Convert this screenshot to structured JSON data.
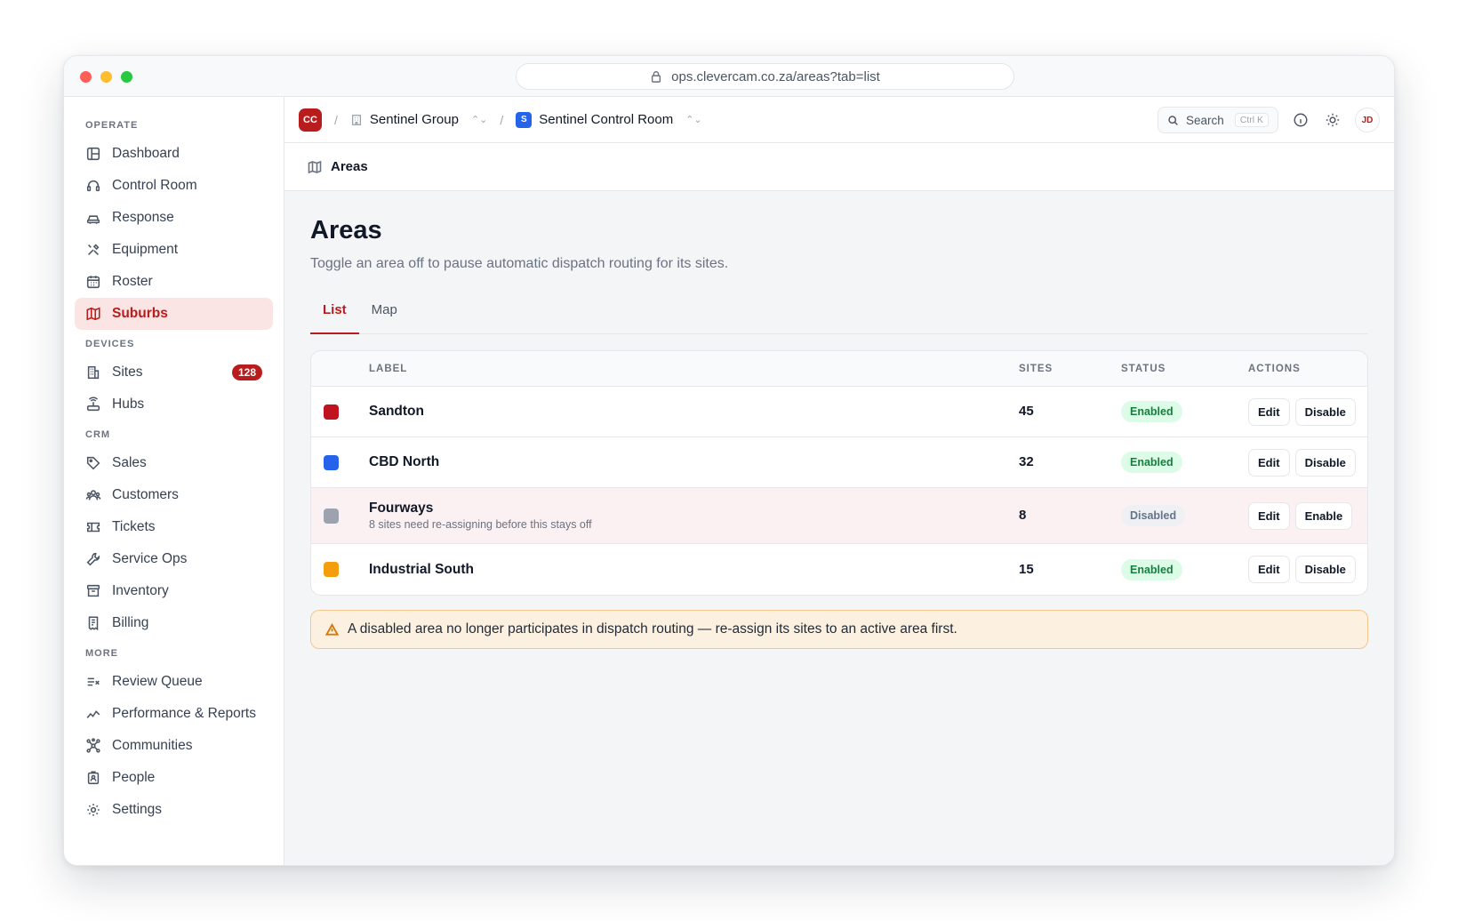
{
  "browser": {
    "url": "ops.clevercam.co.za/areas?tab=list"
  },
  "topbar": {
    "logo": "CC",
    "org": "Sentinel Group",
    "workspace_badge": "S",
    "workspace": "Sentinel Control Room",
    "search_label": "Search",
    "search_shortcut": "Ctrl K",
    "avatar": "JD"
  },
  "sidebar": {
    "sections": [
      {
        "title": "OPERATE",
        "items": [
          {
            "label": "Dashboard",
            "icon": "layout-icon"
          },
          {
            "label": "Control Room",
            "icon": "headset-icon"
          },
          {
            "label": "Response",
            "icon": "car-icon"
          },
          {
            "label": "Equipment",
            "icon": "tools-icon"
          },
          {
            "label": "Roster",
            "icon": "calendar-icon"
          },
          {
            "label": "Suburbs",
            "icon": "map-icon",
            "active": true
          }
        ]
      },
      {
        "title": "DEVICES",
        "items": [
          {
            "label": "Sites",
            "icon": "building-icon",
            "badge": "128"
          },
          {
            "label": "Hubs",
            "icon": "router-icon"
          }
        ]
      },
      {
        "title": "CRM",
        "items": [
          {
            "label": "Sales",
            "icon": "tag-icon"
          },
          {
            "label": "Customers",
            "icon": "users-icon"
          },
          {
            "label": "Tickets",
            "icon": "ticket-icon"
          },
          {
            "label": "Service Ops",
            "icon": "wrench-icon"
          },
          {
            "label": "Inventory",
            "icon": "archive-icon"
          },
          {
            "label": "Billing",
            "icon": "receipt-icon"
          }
        ]
      },
      {
        "title": "MORE",
        "items": [
          {
            "label": "Review Queue",
            "icon": "list-check-icon"
          },
          {
            "label": "Performance & Reports",
            "icon": "trend-icon"
          },
          {
            "label": "Communities",
            "icon": "network-icon"
          },
          {
            "label": "People",
            "icon": "id-badge-icon"
          },
          {
            "label": "Settings",
            "icon": "gear-icon"
          }
        ]
      }
    ]
  },
  "page": {
    "breadcrumb": "Areas",
    "title": "Areas",
    "subtitle": "Toggle an area off to pause automatic dispatch routing for its sites.",
    "tabs": [
      {
        "label": "List",
        "active": true
      },
      {
        "label": "Map",
        "active": false
      }
    ]
  },
  "table": {
    "headers": {
      "label": "LABEL",
      "sites": "SITES",
      "status": "STATUS",
      "actions": "ACTIONS"
    },
    "rows": [
      {
        "label": "Sandton",
        "note": "",
        "sites": "45",
        "status": "Enabled",
        "color": "#c1121f",
        "edit": "Edit",
        "toggle": "Disable",
        "warn": false
      },
      {
        "label": "CBD North",
        "note": "",
        "sites": "32",
        "status": "Enabled",
        "color": "#2563eb",
        "edit": "Edit",
        "toggle": "Disable",
        "warn": false
      },
      {
        "label": "Fourways",
        "note": "8 sites need re-assigning before this stays off",
        "sites": "8",
        "status": "Disabled",
        "color": "#9ca3af",
        "edit": "Edit",
        "toggle": "Enable",
        "warn": true
      },
      {
        "label": "Industrial South",
        "note": "",
        "sites": "15",
        "status": "Enabled",
        "color": "#f59e0b",
        "edit": "Edit",
        "toggle": "Disable",
        "warn": false
      }
    ]
  },
  "alert": {
    "text": "A disabled area no longer participates in dispatch routing — re-assign its sites to an active area first.",
    "icon": "warning-triangle-icon"
  },
  "colors": {
    "accent": "#b91c1c",
    "enabled": "#15803d",
    "warning": "#d97706"
  }
}
